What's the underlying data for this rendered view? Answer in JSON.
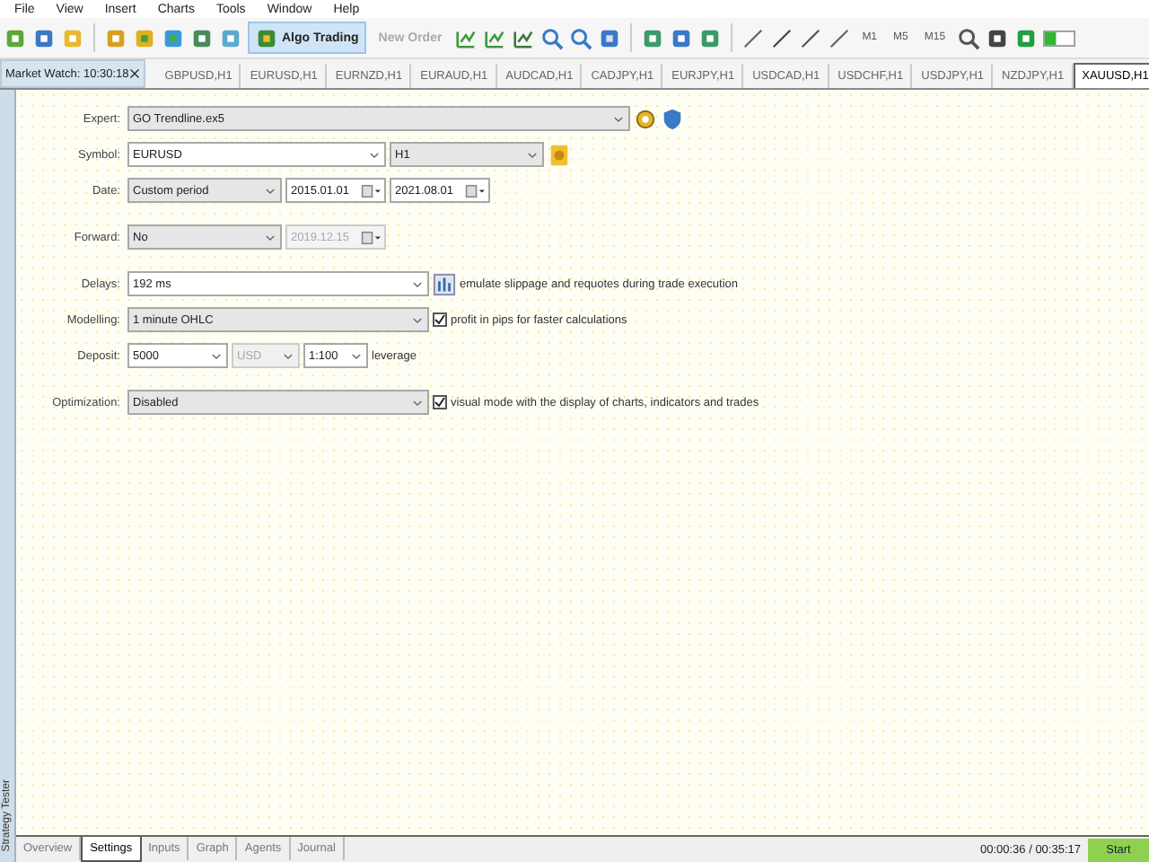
{
  "menu": [
    "File",
    "View",
    "Insert",
    "Charts",
    "Tools",
    "Window",
    "Help"
  ],
  "toolbar": {
    "algo_trading": {
      "label": "Algo Trading",
      "on": true
    },
    "new_order": {
      "label": "New Order",
      "disabled": true
    },
    "timeframes": [
      "M1",
      "M5",
      "M15"
    ]
  },
  "market_watch": {
    "title": "Market Watch: 10:30:18"
  },
  "chart_tabs": [
    {
      "label": "GBPUSD,H1",
      "selected": false
    },
    {
      "label": "EURUSD,H1",
      "selected": false
    },
    {
      "label": "EURNZD,H1",
      "selected": false
    },
    {
      "label": "EURAUD,H1",
      "selected": false
    },
    {
      "label": "AUDCAD,H1",
      "selected": false
    },
    {
      "label": "CADJPY,H1",
      "selected": false
    },
    {
      "label": "EURJPY,H1",
      "selected": false
    },
    {
      "label": "USDCAD,H1",
      "selected": false
    },
    {
      "label": "USDCHF,H1",
      "selected": false
    },
    {
      "label": "USDJPY,H1",
      "selected": false
    },
    {
      "label": "NZDJPY,H1",
      "selected": false
    },
    {
      "label": "XAUUSD,H1",
      "selected": true
    }
  ],
  "side_panel": {
    "title": "Strategy Tester"
  },
  "settings": [
    [
      {
        "label": "Expert:",
        "fields": [
          {
            "kind": "select",
            "value": "GO Trendline.ex5"
          },
          {
            "kind": "icon"
          },
          {
            "kind": "icon"
          }
        ]
      },
      {
        "label": "Symbol:",
        "fields": [
          {
            "kind": "combo",
            "value": "EURUSD"
          },
          {
            "kind": "select",
            "value": "H1"
          },
          {
            "kind": "icon"
          }
        ]
      },
      {
        "label": "Date:",
        "fields": [
          {
            "kind": "select",
            "value": "Custom period"
          },
          {
            "kind": "date",
            "value": "2015.01.01",
            "disabled": false
          },
          {
            "kind": "date",
            "value": "2021.08.01",
            "disabled": false
          }
        ]
      }
    ],
    [
      {
        "label": "Forward:",
        "fields": [
          {
            "kind": "select",
            "value": "No"
          },
          {
            "kind": "date",
            "value": "2019.12.15",
            "disabled": true
          }
        ]
      }
    ],
    [
      {
        "label": "Delays:",
        "fields": [
          {
            "kind": "combo",
            "value": "192 ms"
          },
          {
            "kind": "icon"
          },
          {
            "kind": "note",
            "text": "emulate slippage and requotes during trade execution"
          }
        ]
      },
      {
        "label": "Modelling:",
        "fields": [
          {
            "kind": "select",
            "value": "1 minute OHLC"
          },
          {
            "kind": "checkbox",
            "text": "profit in pips for faster calculations",
            "checked": true
          }
        ]
      },
      {
        "label": "Deposit:",
        "fields": [
          {
            "kind": "combo",
            "value": "5000"
          },
          {
            "kind": "disabled_select",
            "value": "USD"
          },
          {
            "kind": "combo",
            "value": "1:100"
          },
          {
            "kind": "note",
            "text": "leverage"
          }
        ]
      }
    ],
    [
      {
        "label": "Optimization:",
        "fields": [
          {
            "kind": "select",
            "value": "Disabled"
          },
          {
            "kind": "checkbox",
            "text": "visual mode with the display of charts, indicators and trades",
            "checked": true
          }
        ]
      }
    ]
  ],
  "bottom_tabs": [
    {
      "label": "Overview",
      "selected": false
    },
    {
      "label": "Settings",
      "selected": true
    },
    {
      "label": "Inputs",
      "selected": false
    },
    {
      "label": "Graph",
      "selected": false
    },
    {
      "label": "Agents",
      "selected": false
    },
    {
      "label": "Journal",
      "selected": false
    }
  ],
  "status": {
    "time": "00:00:36 / 00:35:17",
    "start": "Start"
  }
}
